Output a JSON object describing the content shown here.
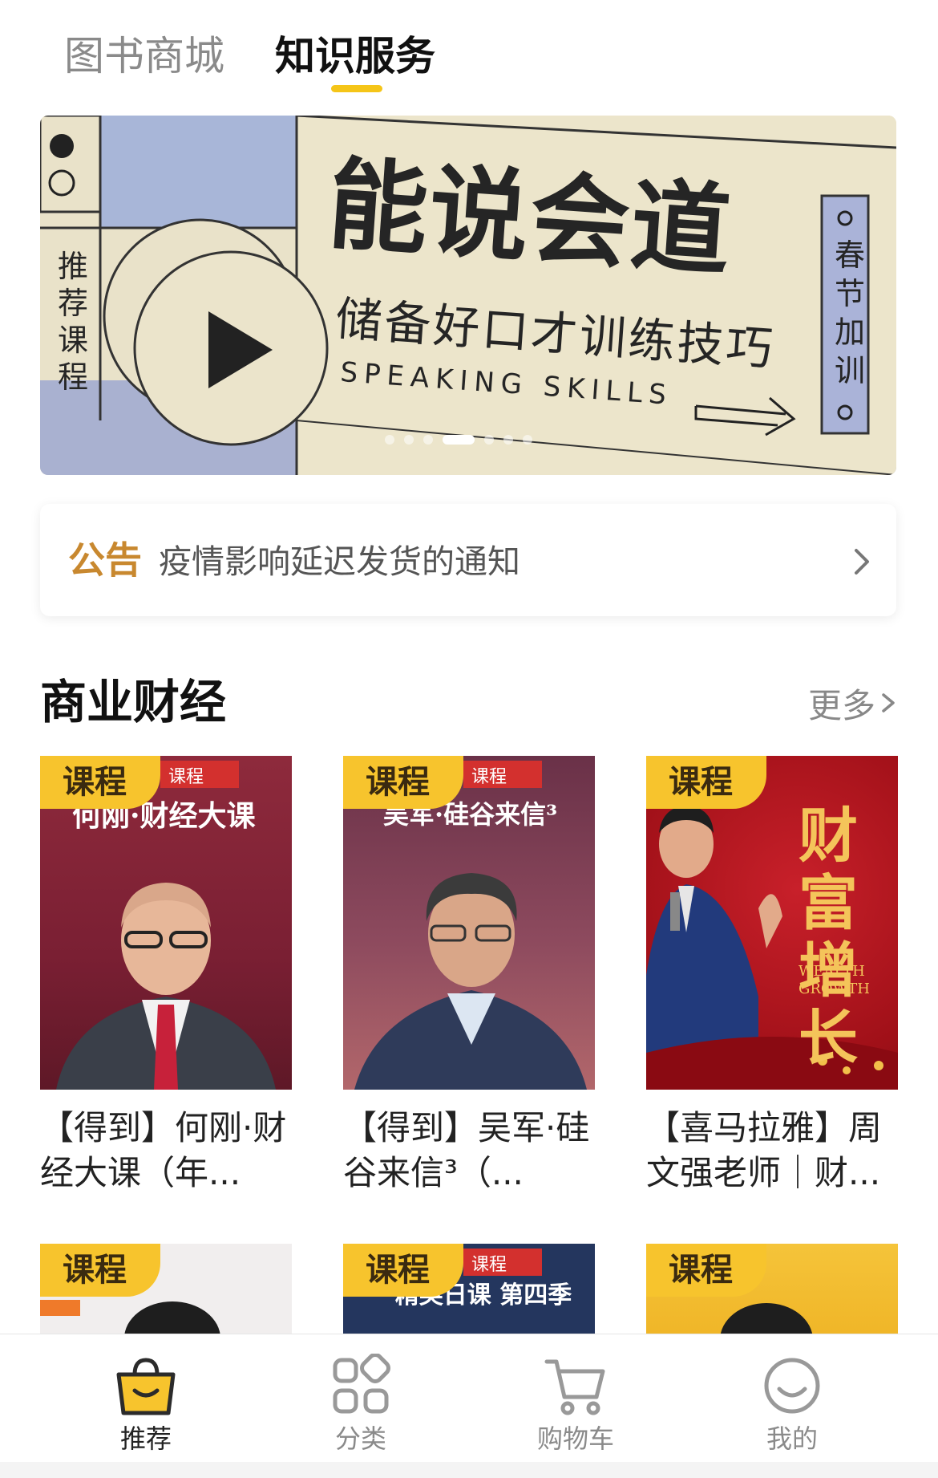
{
  "top_tabs": {
    "books": "图书商城",
    "knowledge": "知识服务"
  },
  "banner": {
    "title": "能说会道",
    "subtitle": "储备好口才训练技巧",
    "english": "SPEAKING SKILLS",
    "left_vertical": "推荐课程",
    "right_vertical": "春节加训",
    "page_count": 7,
    "active_page": 3
  },
  "notice": {
    "tag": "公告",
    "text": "疫情影响延迟发货的通知"
  },
  "section": {
    "title": "商业财经",
    "more": "更多"
  },
  "course_tag": "课程",
  "courses": [
    {
      "title": "【得到】何刚·财经大课（年...",
      "cover_text": "何刚·财经大课",
      "cover_label": "课程"
    },
    {
      "title": "【得到】吴军·硅谷来信³（...",
      "cover_text": "吴军·硅谷来信³",
      "cover_label": "课程"
    },
    {
      "title": "【喜马拉雅】周文强老师｜财...",
      "cover_text": "财富增长",
      "cover_en": "WEALTH GROWTH"
    },
    {
      "title": ""
    },
    {
      "title": "",
      "cover_text": "精英日课 第四季",
      "cover_label": "课程"
    },
    {
      "title": ""
    }
  ],
  "bottom_nav": [
    {
      "label": "推荐",
      "icon": "shopping-bag-icon",
      "active": true
    },
    {
      "label": "分类",
      "icon": "grid-icon",
      "active": false
    },
    {
      "label": "购物车",
      "icon": "cart-icon",
      "active": false
    },
    {
      "label": "我的",
      "icon": "smile-face-icon",
      "active": false
    }
  ],
  "colors": {
    "accent": "#f5c518",
    "notice_tag": "#c8882f"
  }
}
